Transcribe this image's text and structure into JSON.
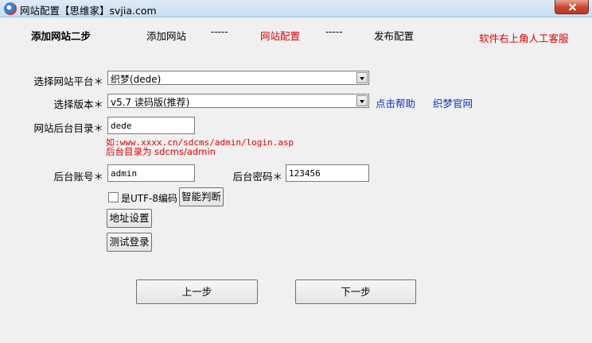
{
  "window": {
    "title": "网站配置【思维家】svjia.com"
  },
  "steps": {
    "current_title": "添加网站二步",
    "step1": "添加网站",
    "sep1": "-----",
    "step2": "网站配置",
    "sep2": "-----",
    "step3": "发布配置",
    "support": "软件右上角人工客服"
  },
  "form": {
    "platform_label": "选择网站平台＊",
    "platform_value": "织梦(dede)",
    "version_label": "选择版本＊",
    "version_value": "v5.7 读码版(推荐)",
    "help_link": "点击帮助",
    "official_link": "织梦官网",
    "admin_dir_label": "网站后台目录＊",
    "admin_dir_value": "dede",
    "hint_line1": "如:www.xxxx.cn/sdcms/admin/login.asp",
    "hint_line2": "后台目录为 sdcms/admin",
    "account_label": "后台账号＊",
    "account_value": "admin",
    "password_label": "后台密码＊",
    "password_value": "123456",
    "utf8_label": "是UTF-8编码",
    "utf8_checked": false,
    "smart_detect": "智能判断",
    "address_settings": "地址设置",
    "test_login": "测试登录"
  },
  "nav": {
    "prev": "上一步",
    "next": "下一步"
  },
  "colors": {
    "accent_red": "#e00000",
    "link_blue": "#1030c0"
  }
}
